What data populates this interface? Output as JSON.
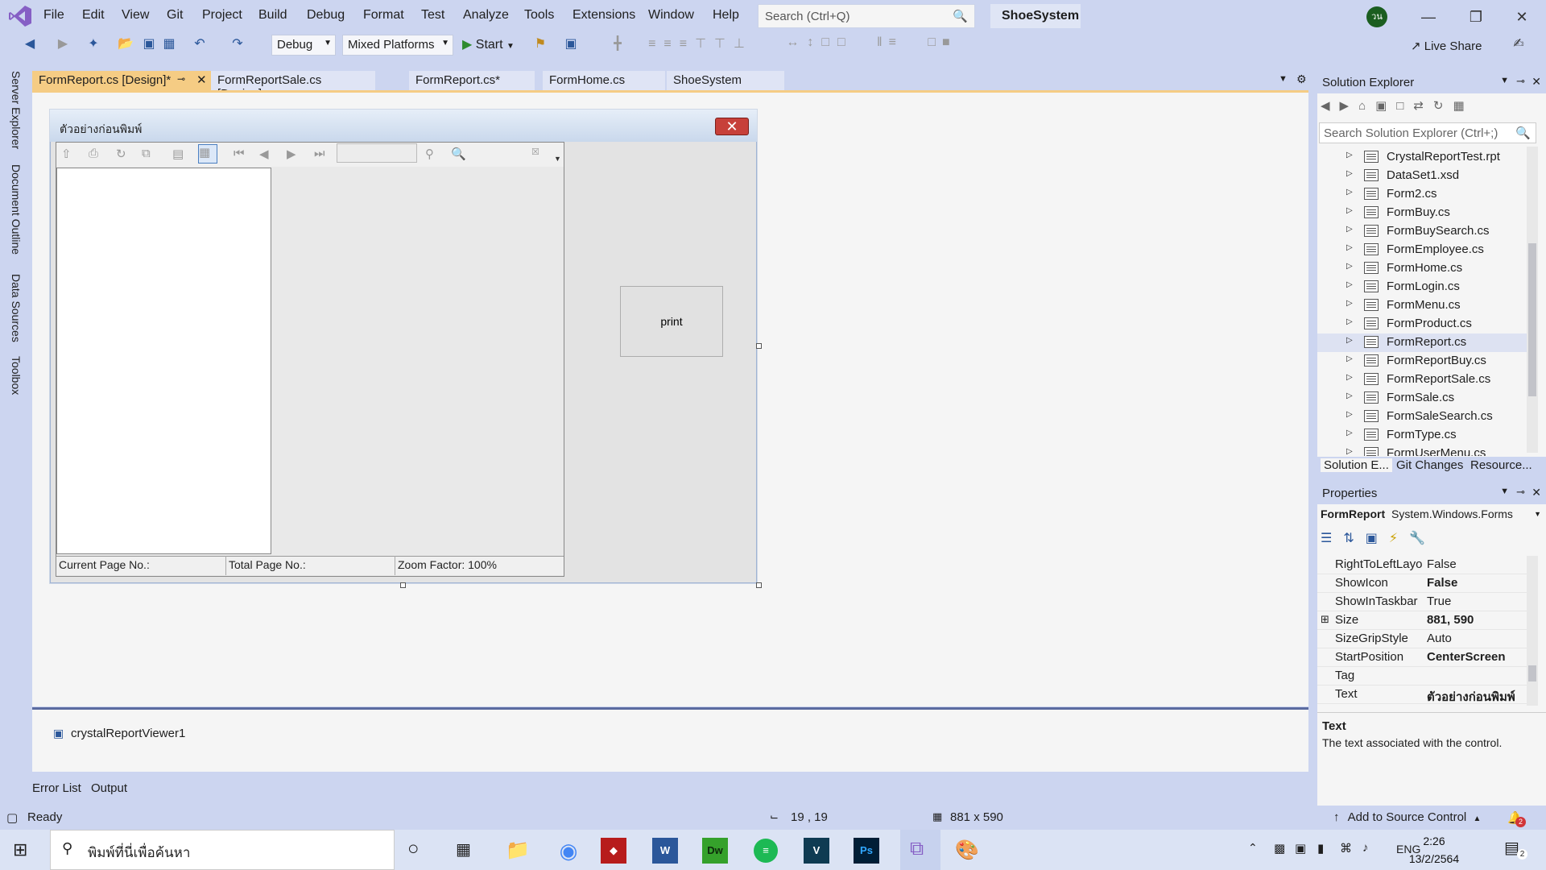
{
  "menu": {
    "items": [
      "File",
      "Edit",
      "View",
      "Git",
      "Project",
      "Build",
      "Debug",
      "Format",
      "Test",
      "Analyze",
      "Tools",
      "Extensions",
      "Window",
      "Help"
    ],
    "search_placeholder": "Search (Ctrl+Q)",
    "solution_name": "ShoeSystem",
    "avatar_initials": "วน"
  },
  "toolbar": {
    "config": "Debug",
    "platform": "Mixed Platforms",
    "start_label": "Start",
    "live_share": "Live Share"
  },
  "left_rail": [
    "Server Explorer",
    "Document Outline",
    "Data Sources",
    "Toolbox"
  ],
  "doc_tabs": [
    "FormReport.cs [Design]*",
    "FormReportSale.cs [Design]",
    "FormReport.cs*",
    "FormHome.cs",
    "ShoeSystem"
  ],
  "designer": {
    "form_title": "ตัวอย่างก่อนพิมพ์",
    "status_current_page": "Current Page No.:",
    "status_total_page": "Total Page No.:",
    "status_zoom": "Zoom Factor: 100%",
    "print_button": "print",
    "tray_component": "crystalReportViewer1"
  },
  "bottom_tabs": [
    "Error List",
    "Output"
  ],
  "solution_explorer": {
    "title": "Solution Explorer",
    "search_placeholder": "Search Solution Explorer (Ctrl+;)",
    "items": [
      "CrystalReportTest.rpt",
      "DataSet1.xsd",
      "Form2.cs",
      "FormBuy.cs",
      "FormBuySearch.cs",
      "FormEmployee.cs",
      "FormHome.cs",
      "FormLogin.cs",
      "FormMenu.cs",
      "FormProduct.cs",
      "FormReport.cs",
      "FormReportBuy.cs",
      "FormReportSale.cs",
      "FormSale.cs",
      "FormSaleSearch.cs",
      "FormType.cs",
      "FormUserMenu.cs"
    ],
    "selected_item": "FormReport.cs",
    "tabs": [
      "Solution E...",
      "Git Changes",
      "Resource..."
    ]
  },
  "properties": {
    "title": "Properties",
    "object_name": "FormReport",
    "object_type": "System.Windows.Forms",
    "rows": [
      {
        "name": "RightToLeftLayo",
        "value": "False",
        "bold": false
      },
      {
        "name": "ShowIcon",
        "value": "False",
        "bold": true
      },
      {
        "name": "ShowInTaskbar",
        "value": "True",
        "bold": false
      },
      {
        "name": "Size",
        "value": "881, 590",
        "bold": true
      },
      {
        "name": "SizeGripStyle",
        "value": "Auto",
        "bold": false
      },
      {
        "name": "StartPosition",
        "value": "CenterScreen",
        "bold": true
      },
      {
        "name": "Tag",
        "value": "",
        "bold": false
      },
      {
        "name": "Text",
        "value": "ตัวอย่างก่อนพิมพ์",
        "bold": true
      }
    ],
    "desc_title": "Text",
    "desc_text": "The text associated with the control."
  },
  "statusbar": {
    "ready": "Ready",
    "position": "19 , 19",
    "size": "881 x 590",
    "source_control": "Add to Source Control",
    "notifications": "2"
  },
  "taskbar": {
    "search_placeholder": "พิมพ์ที่นี่เพื่อค้นหา",
    "lang": "ENG",
    "time": "2:26",
    "date": "13/2/2564",
    "notification_count": "2"
  },
  "colors": {
    "chrome": "#ccd5f0",
    "active_tab": "#f5cc84",
    "vs_purple": "#865fc5"
  }
}
